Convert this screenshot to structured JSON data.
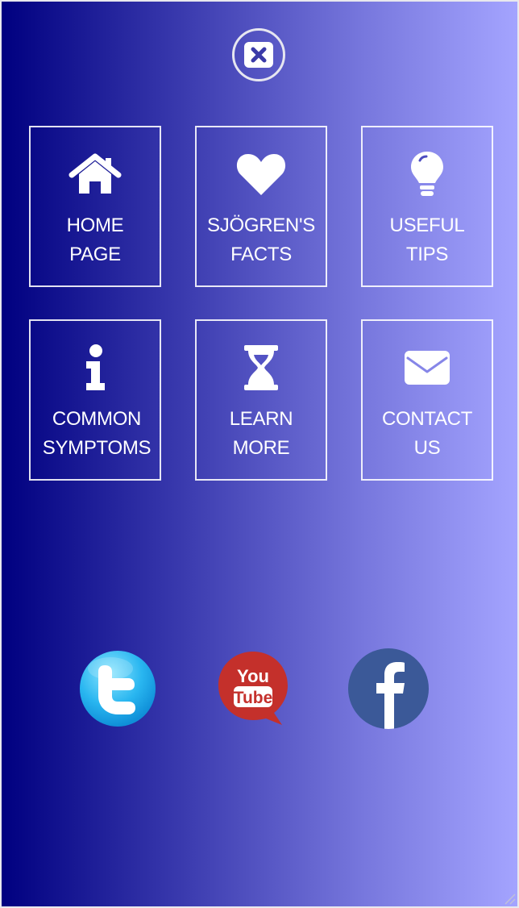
{
  "close_button": {
    "icon": "close-x-icon",
    "color": "#e6e6f0"
  },
  "menu": {
    "tiles": [
      {
        "line1": "HOME",
        "line2": "PAGE",
        "icon": "home-icon"
      },
      {
        "line1": "SJÖGREN'S",
        "line2": "FACTS",
        "icon": "heart-icon"
      },
      {
        "line1": "USEFUL",
        "line2": "TIPS",
        "icon": "lightbulb-icon"
      },
      {
        "line1": "COMMON",
        "line2": "SYMPTOMS",
        "icon": "info-icon"
      },
      {
        "line1": "LEARN",
        "line2": "MORE",
        "icon": "hourglass-icon"
      },
      {
        "line1": "CONTACT",
        "line2": "US",
        "icon": "envelope-icon"
      }
    ]
  },
  "social": {
    "twitter": {
      "icon": "twitter-icon",
      "color": "#29b6f0"
    },
    "youtube": {
      "icon": "youtube-icon",
      "color": "#c4302b",
      "text_top": "You",
      "text_bottom": "Tube"
    },
    "facebook": {
      "icon": "facebook-icon",
      "color": "#3b5998"
    }
  },
  "colors": {
    "gradient_start": "#000080",
    "gradient_end": "#a4a4ff",
    "tile_border": "#ffffff"
  }
}
